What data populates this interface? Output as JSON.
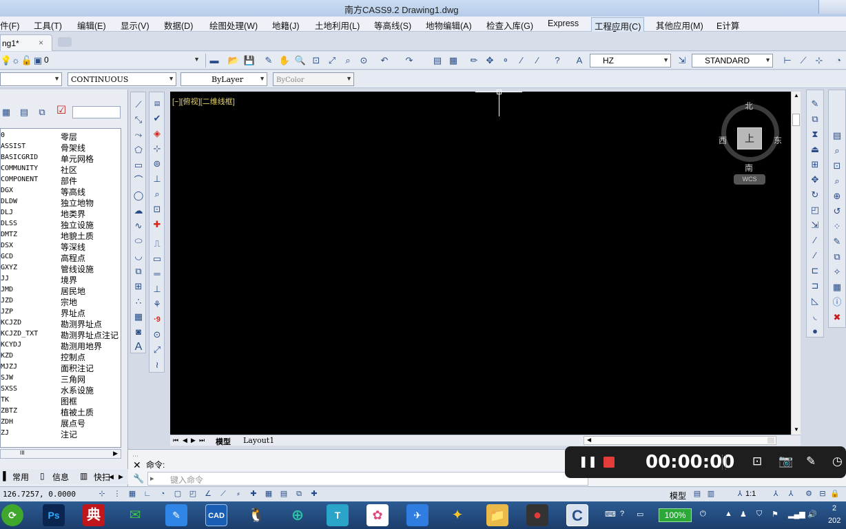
{
  "window": {
    "title": "南方CASS9.2    Drawing1.dwg"
  },
  "menu": [
    "件(F)",
    "工具(T)",
    "编辑(E)",
    "显示(V)",
    "数据(D)",
    "绘图处理(W)",
    "地籍(J)",
    "土地利用(L)",
    "等高线(S)",
    "地物编辑(A)",
    "检查入库(G)",
    "Express",
    "工程应用(C)",
    "其他应用(M)",
    "E计算"
  ],
  "active_menu_index": 12,
  "doc_tab": {
    "label": "ng1*",
    "close": "×"
  },
  "toolbar": {
    "layer_value": "0",
    "textstyle_value": "HZ",
    "dimstyle_value": "STANDARD",
    "linetype_value": "CONTINUOUS",
    "lineweight_value": "ByLayer",
    "plotstyle_value": "ByColor"
  },
  "layers": [
    {
      "code": "0",
      "name": "零层"
    },
    {
      "code": "ASSIST",
      "name": "骨架线"
    },
    {
      "code": "BASICGRID",
      "name": "单元网格"
    },
    {
      "code": "COMMUNITY",
      "name": "社区"
    },
    {
      "code": "COMPONENT",
      "name": "部件"
    },
    {
      "code": "DGX",
      "name": "等高线"
    },
    {
      "code": "DLDW",
      "name": "独立地物"
    },
    {
      "code": "DLJ",
      "name": "地类界"
    },
    {
      "code": "DLSS",
      "name": "独立设施"
    },
    {
      "code": "DMTZ",
      "name": "地貌土质"
    },
    {
      "code": "DSX",
      "name": "等深线"
    },
    {
      "code": "GCD",
      "name": "高程点"
    },
    {
      "code": "GXYZ",
      "name": "管线设施"
    },
    {
      "code": "JJ",
      "name": "境界"
    },
    {
      "code": "JMD",
      "name": "居民地"
    },
    {
      "code": "JZD",
      "name": "宗地"
    },
    {
      "code": "JZP",
      "name": "界址点"
    },
    {
      "code": "KCJZD",
      "name": "勘测界址点"
    },
    {
      "code": "KCJZD_TXT",
      "name": "勘测界址点注记"
    },
    {
      "code": "KCYDJ",
      "name": "勘测用地界"
    },
    {
      "code": "KZD",
      "name": "控制点"
    },
    {
      "code": "MJZJ",
      "name": "面积注记"
    },
    {
      "code": "SJW",
      "name": "三角网"
    },
    {
      "code": "SXSS",
      "name": "水系设施"
    },
    {
      "code": "TK",
      "name": "图框"
    },
    {
      "code": "ZBTZ",
      "name": "植被土质"
    },
    {
      "code": "ZDH",
      "name": "展点号"
    },
    {
      "code": "ZJ",
      "name": "注记"
    }
  ],
  "left_panel": {
    "scroll_label": "III",
    "tabs": [
      "常用",
      "信息",
      "快扫"
    ]
  },
  "canvas": {
    "view_label": "[−][俯视][二维线框]"
  },
  "compass": {
    "north": "北",
    "south": "南",
    "east": "东",
    "west": "西",
    "top": "上",
    "wcs": "WCS"
  },
  "layout_tabs": [
    "模型",
    "Layout1"
  ],
  "command": {
    "label": "命令:",
    "placeholder": "键入命令"
  },
  "recorder": {
    "timer": "00:00:00"
  },
  "status": {
    "coords": "126.7257, 0.0000",
    "model_label": "模型",
    "scale": "1:1",
    "battery": "100%"
  },
  "taskbar_apps": [
    "⟳",
    "Ps",
    "典",
    "✉",
    "✎",
    "CAD",
    "🐧",
    "⊕",
    "T",
    "✿",
    "✈",
    "✦",
    "📁",
    "●",
    "C"
  ],
  "clock_partial": {
    "top": "2",
    "bottom": "202"
  },
  "colors": {
    "canvas_bg": "#000000",
    "view_label": "#e6d36a",
    "record_stop": "#e43b3b"
  }
}
